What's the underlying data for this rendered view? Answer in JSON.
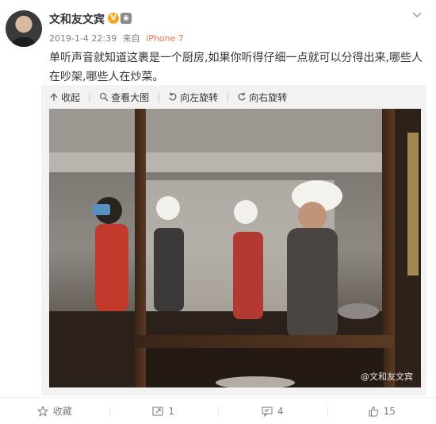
{
  "post": {
    "username": "文和友文宾",
    "verified_badge": "V",
    "level_badge": "🤖",
    "date": "2019-1-4 22:39",
    "source_prefix": "来自",
    "source": "iPhone 7",
    "text": "单听声音就知道这裹是一个厨房,如果你听得仔细一点就可以分得出来,哪些人在吵架,哪些人在炒菜。"
  },
  "media_toolbar": {
    "collapse": "收起",
    "view_large": "查看大图",
    "rotate_left": "向左旋转",
    "rotate_right": "向右旋转"
  },
  "photo": {
    "watermark": "@文和友文宾"
  },
  "footer": {
    "favorite": "收藏",
    "repost_count": "1",
    "comment_count": "4",
    "like_count": "15"
  },
  "colors": {
    "link": "#eb7350",
    "muted": "#808080",
    "badge": "#f5a623"
  }
}
